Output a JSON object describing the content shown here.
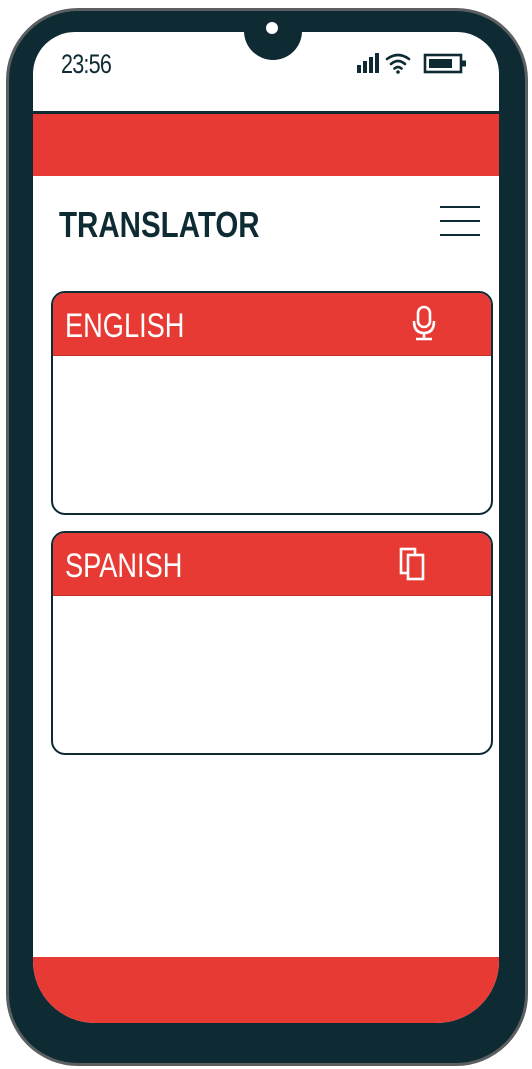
{
  "status_bar": {
    "time": "23:56",
    "icons": [
      "signal-icon",
      "wifi-icon",
      "battery-icon"
    ]
  },
  "header": {
    "title": "TRANSLATOR",
    "menu_icon": "hamburger-menu-icon"
  },
  "source_panel": {
    "language": "ENGLISH",
    "action_icon": "microphone-icon",
    "text": ""
  },
  "target_panel": {
    "language": "SPANISH",
    "action_icon": "copy-icon",
    "text": ""
  },
  "colors": {
    "accent": "#e83a34",
    "dark": "#0e2a33",
    "background": "#ffffff",
    "frame_border": "#5b5f61"
  }
}
